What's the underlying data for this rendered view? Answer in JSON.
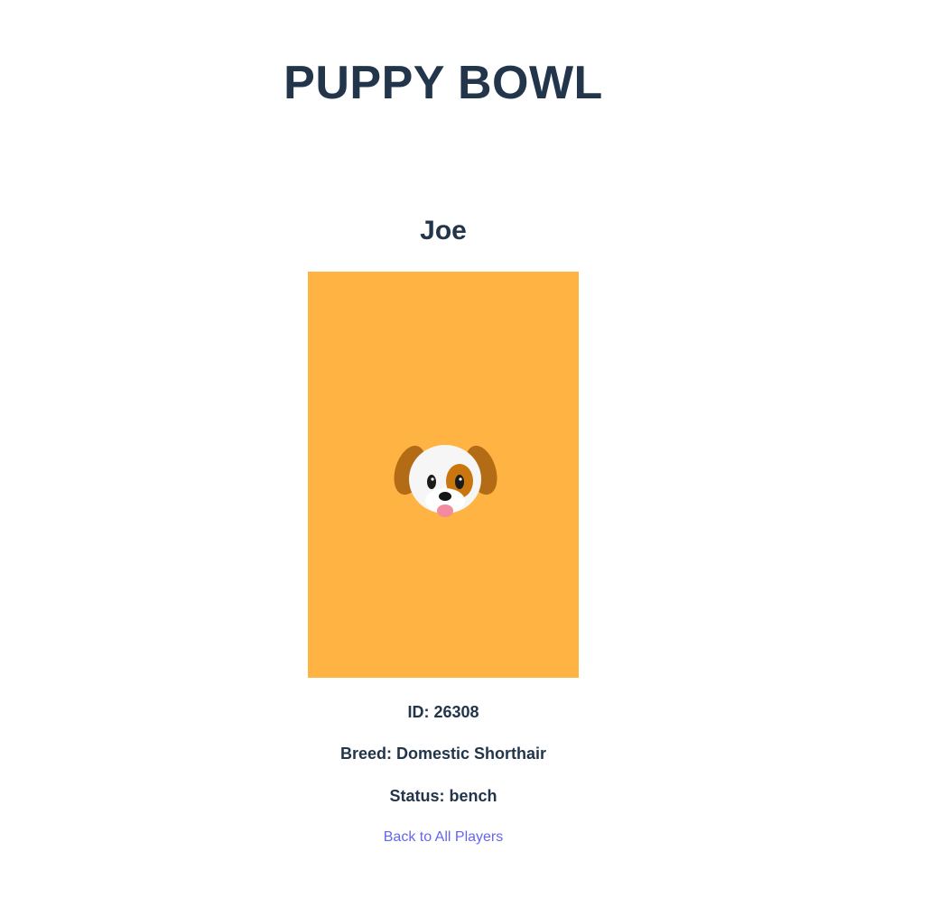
{
  "app": {
    "title": "PUPPY BOWL"
  },
  "player": {
    "name": "Joe",
    "image_bg_color": "#feb342",
    "image_icon": "dog-face-icon",
    "id_text": "ID: 26308",
    "breed_text": "Breed: Domestic Shorthair",
    "status_text": "Status: bench"
  },
  "nav": {
    "back_label": "Back to All Players"
  },
  "colors": {
    "heading": "#22354a",
    "link": "#6466f1"
  }
}
